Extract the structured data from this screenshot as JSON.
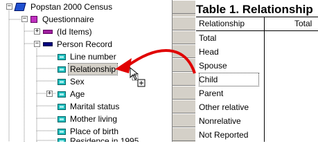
{
  "tree": {
    "root": "Popstan 2000 Census",
    "level": "Questionnaire",
    "id_items": "(Id Items)",
    "record": "Person Record",
    "items": [
      "Line number",
      "Relationship",
      "Sex",
      "Age",
      "Marital status",
      "Mother living",
      "Place of birth",
      "Residence in 1995"
    ],
    "selected_item": "Relationship",
    "expanded_symbol": "−",
    "collapsed_symbol": "+"
  },
  "table": {
    "title": "Table 1. Relationship",
    "stub_header": "Relationship",
    "column_header": "Total",
    "stubs": [
      "Total",
      "Head",
      "Spouse",
      "Child",
      "Parent",
      "Other relative",
      "Nonrelative",
      "Not Reported"
    ],
    "highlighted_stub": "Child"
  },
  "colors": {
    "accent_arrow": "#e00000",
    "selection_bg": "#d4d0c8",
    "item_icon": "#20c0c0",
    "record_icon": "#000080",
    "level_icon": "#c030c0"
  },
  "icons": {
    "root": "book-icon",
    "level": "level-icon",
    "id_items": "id-record-icon",
    "record": "record-icon",
    "item": "item-icon",
    "drag_cursor": "drag-copy-cursor-icon"
  }
}
